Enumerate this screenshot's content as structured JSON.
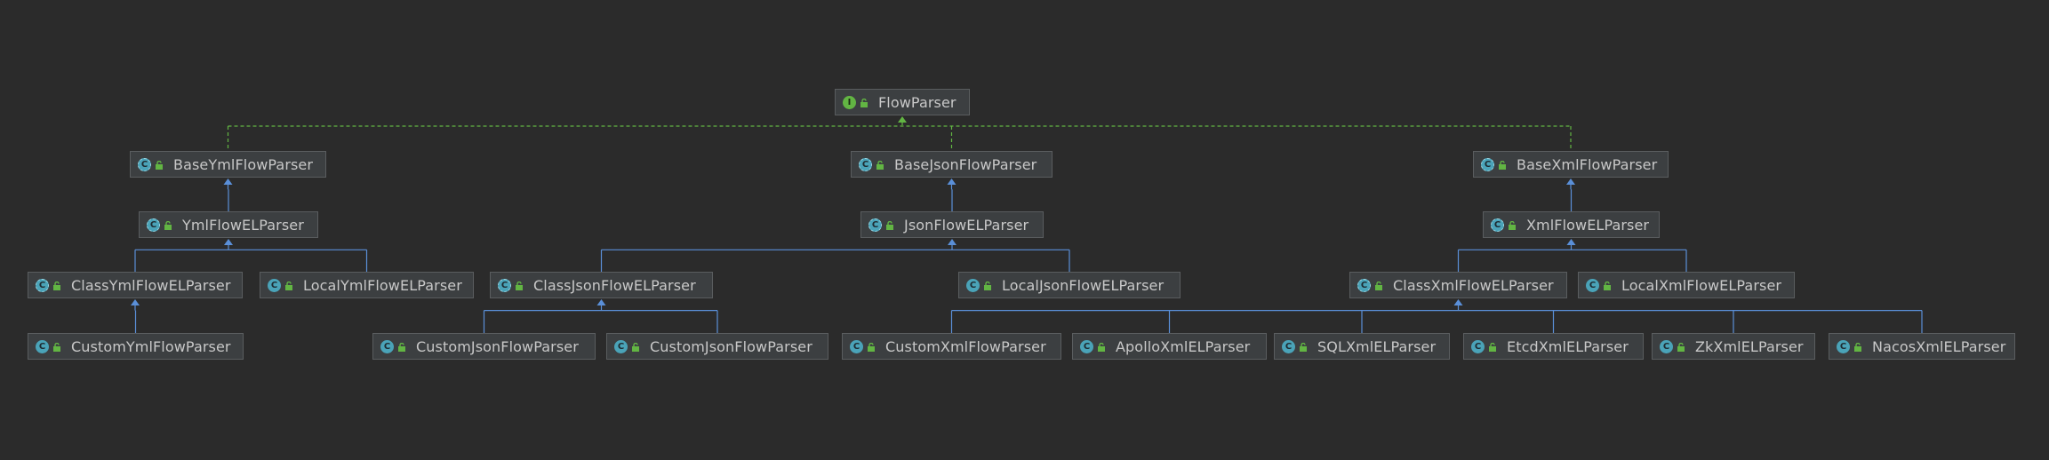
{
  "colors": {
    "background": "#2b2b2b",
    "node_fill": "#3c3f41",
    "node_border": "#5a5d5f",
    "text": "#c8c8c8",
    "extends_edge": "#5a8fd8",
    "implements_edge": "#62b543",
    "interface_icon": "#62b543",
    "class_icon": "#4aa3b8",
    "visibility_icon": "#62b543"
  },
  "icons": {
    "interface": "interface-icon",
    "class": "class-icon",
    "abstract": "abstract-class-icon",
    "visibility": "public-lock-icon"
  },
  "nodes": [
    {
      "id": "flow-parser",
      "label": "FlowParser",
      "kind": "interface"
    },
    {
      "id": "base-yml-flow-parser",
      "label": "BaseYmlFlowParser",
      "kind": "abstract"
    },
    {
      "id": "base-json-flow-parser",
      "label": "BaseJsonFlowParser",
      "kind": "abstract"
    },
    {
      "id": "base-xml-flow-parser",
      "label": "BaseXmlFlowParser",
      "kind": "abstract"
    },
    {
      "id": "yml-flow-el-parser",
      "label": "YmlFlowELParser",
      "kind": "abstract"
    },
    {
      "id": "json-flow-el-parser",
      "label": "JsonFlowELParser",
      "kind": "abstract"
    },
    {
      "id": "xml-flow-el-parser",
      "label": "XmlFlowELParser",
      "kind": "abstract"
    },
    {
      "id": "class-yml-flow-el-parser",
      "label": "ClassYmlFlowELParser",
      "kind": "abstract"
    },
    {
      "id": "local-yml-flow-el-parser",
      "label": "LocalYmlFlowELParser",
      "kind": "class"
    },
    {
      "id": "class-json-flow-el-parser",
      "label": "ClassJsonFlowELParser",
      "kind": "abstract"
    },
    {
      "id": "local-json-flow-el-parser",
      "label": "LocalJsonFlowELParser",
      "kind": "class"
    },
    {
      "id": "class-xml-flow-el-parser",
      "label": "ClassXmlFlowELParser",
      "kind": "abstract"
    },
    {
      "id": "local-xml-flow-el-parser",
      "label": "LocalXmlFlowELParser",
      "kind": "class"
    },
    {
      "id": "custom-yml-flow-parser",
      "label": "CustomYmlFlowParser",
      "kind": "class"
    },
    {
      "id": "custom-json-flow-parser-1",
      "label": "CustomJsonFlowParser",
      "kind": "class"
    },
    {
      "id": "custom-json-flow-parser-2",
      "label": "CustomJsonFlowParser",
      "kind": "class"
    },
    {
      "id": "custom-xml-flow-parser",
      "label": "CustomXmlFlowParser",
      "kind": "class"
    },
    {
      "id": "apollo-xml-el-parser",
      "label": "ApolloXmlELParser",
      "kind": "class"
    },
    {
      "id": "sql-xml-el-parser",
      "label": "SQLXmlELParser",
      "kind": "class"
    },
    {
      "id": "etcd-xml-el-parser",
      "label": "EtcdXmlELParser",
      "kind": "class"
    },
    {
      "id": "zk-xml-el-parser",
      "label": "ZkXmlELParser",
      "kind": "class"
    },
    {
      "id": "nacos-xml-el-parser",
      "label": "NacosXmlELParser",
      "kind": "class"
    }
  ],
  "edges": [
    {
      "from": "base-yml-flow-parser",
      "to": "flow-parser",
      "type": "implements"
    },
    {
      "from": "base-json-flow-parser",
      "to": "flow-parser",
      "type": "implements"
    },
    {
      "from": "base-xml-flow-parser",
      "to": "flow-parser",
      "type": "implements"
    },
    {
      "from": "yml-flow-el-parser",
      "to": "base-yml-flow-parser",
      "type": "extends"
    },
    {
      "from": "json-flow-el-parser",
      "to": "base-json-flow-parser",
      "type": "extends"
    },
    {
      "from": "xml-flow-el-parser",
      "to": "base-xml-flow-parser",
      "type": "extends"
    },
    {
      "from": "class-yml-flow-el-parser",
      "to": "yml-flow-el-parser",
      "type": "extends"
    },
    {
      "from": "local-yml-flow-el-parser",
      "to": "yml-flow-el-parser",
      "type": "extends"
    },
    {
      "from": "class-json-flow-el-parser",
      "to": "json-flow-el-parser",
      "type": "extends"
    },
    {
      "from": "local-json-flow-el-parser",
      "to": "json-flow-el-parser",
      "type": "extends"
    },
    {
      "from": "class-xml-flow-el-parser",
      "to": "xml-flow-el-parser",
      "type": "extends"
    },
    {
      "from": "local-xml-flow-el-parser",
      "to": "xml-flow-el-parser",
      "type": "extends"
    },
    {
      "from": "custom-yml-flow-parser",
      "to": "class-yml-flow-el-parser",
      "type": "extends"
    },
    {
      "from": "custom-json-flow-parser-1",
      "to": "class-json-flow-el-parser",
      "type": "extends"
    },
    {
      "from": "custom-json-flow-parser-2",
      "to": "class-json-flow-el-parser",
      "type": "extends"
    },
    {
      "from": "custom-xml-flow-parser",
      "to": "class-xml-flow-el-parser",
      "type": "extends"
    },
    {
      "from": "apollo-xml-el-parser",
      "to": "class-xml-flow-el-parser",
      "type": "extends"
    },
    {
      "from": "sql-xml-el-parser",
      "to": "class-xml-flow-el-parser",
      "type": "extends"
    },
    {
      "from": "etcd-xml-el-parser",
      "to": "class-xml-flow-el-parser",
      "type": "extends"
    },
    {
      "from": "zk-xml-el-parser",
      "to": "class-xml-flow-el-parser",
      "type": "extends"
    },
    {
      "from": "nacos-xml-el-parser",
      "to": "class-xml-flow-el-parser",
      "type": "extends"
    }
  ]
}
